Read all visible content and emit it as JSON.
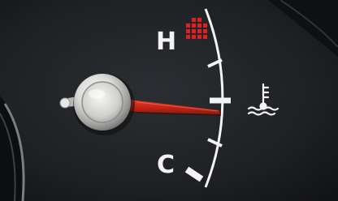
{
  "gauge": {
    "type": "coolant-temperature-gauge",
    "labels": {
      "hot": "H",
      "cold": "C"
    },
    "icon": "coolant-temperature-icon",
    "warning_icon": "red-dot-warning-icon",
    "needle_reading": "middle",
    "needle_fraction": 0.5,
    "colors": {
      "dial": "#1c1e21",
      "markings": "#f3f3f3",
      "needle": "#d32a1c",
      "warning": "#e02020"
    }
  }
}
